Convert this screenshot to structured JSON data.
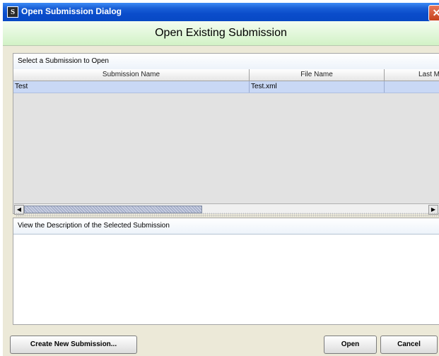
{
  "window": {
    "title": "Open Submission Dialog",
    "app_icon": "S",
    "close_glyph": "✕"
  },
  "header": {
    "title": "Open Existing Submission"
  },
  "submissions": {
    "label": "Select a Submission to Open",
    "columns": [
      "Submission Name",
      "File Name",
      "Last M"
    ],
    "rows": [
      {
        "name": "Test",
        "file": "Test.xml",
        "last": ""
      }
    ]
  },
  "description": {
    "label": "View the Description of the Selected Submission",
    "text": ""
  },
  "buttons": {
    "create": "Create New Submission...",
    "open": "Open",
    "cancel": "Cancel"
  },
  "scroll": {
    "left": "◀",
    "right": "▶"
  }
}
